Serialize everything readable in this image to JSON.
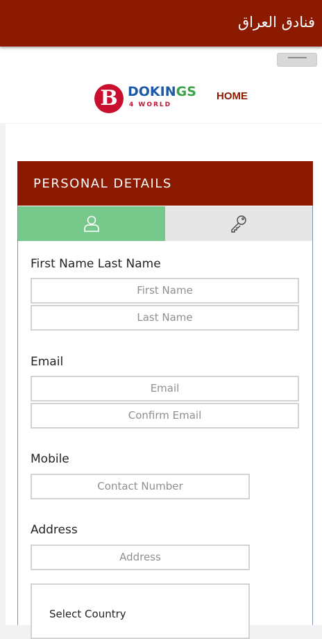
{
  "appbar": {
    "title": "فنادق العراق"
  },
  "logo": {
    "brand_part1": "DOKIN",
    "brand_part2": "GS",
    "tagline": "4 WORLD",
    "mark_letter": "B"
  },
  "nav": {
    "home_label": "HOME"
  },
  "panel": {
    "header": "PERSONAL DETAILS",
    "tabs": [
      {
        "icon": "user-icon",
        "active": true
      },
      {
        "icon": "key-icon",
        "active": false
      }
    ]
  },
  "form": {
    "name": {
      "label": "First Name Last Name",
      "first_placeholder": "First Name",
      "last_placeholder": "Last Name"
    },
    "email": {
      "label": "Email",
      "email_placeholder": "Email",
      "confirm_placeholder": "Confirm Email"
    },
    "mobile": {
      "label": "Mobile",
      "placeholder": "Contact Number"
    },
    "address": {
      "label": "Address",
      "placeholder": "Address",
      "country_select": "Select Country"
    }
  },
  "colors": {
    "primary": "#8b1a00",
    "active_tab": "#76c98a",
    "inactive_tab": "#e6e6e6",
    "logo_red": "#c8102e",
    "logo_blue": "#1c5aa8",
    "logo_green": "#3aa34a"
  }
}
